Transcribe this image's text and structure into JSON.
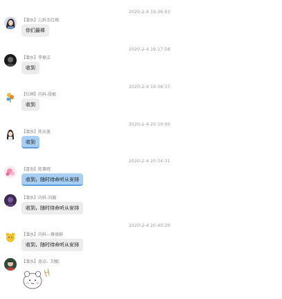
{
  "timestamps": [
    "2020-2-4 19:36:03",
    "2020-2-4 19:17:58",
    "2020-2-4 19:38:37",
    "2020-2-4 20:19:00",
    "2020-2-4 20:34:31",
    "2020-2-4 20:40:20"
  ],
  "messages": [
    {
      "sender": "【潜水】儿科王红梅",
      "text": "你们最棒",
      "avatar": "woman-dark-hair-avatar-icon"
    },
    {
      "sender": "【潜水】李振江",
      "text": "收到",
      "avatar": "black-portrait-avatar-icon"
    },
    {
      "sender": "【社牌】内科-段敏",
      "text": "收到",
      "avatar": "flower-avatar-icon"
    },
    {
      "sender": "【潜水】陈光美",
      "text": "收到",
      "avatar": "girl-avatar-icon"
    },
    {
      "sender": "【冒泡】陈秉辉",
      "text": "收到，随时待命听从安排",
      "avatar": "pink-flower-avatar-icon"
    },
    {
      "sender": "【潜水】内科-刘璐",
      "text": "收到，随时待命听从安排",
      "avatar": "purple-portrait-avatar-icon"
    },
    {
      "sender": "【潜水】内科—蔡德蔚",
      "text": "收到，随时待命听从安排",
      "avatar": "yellow-cartoon-avatar-icon"
    },
    {
      "sender": "【潜水】急诊、刘敏",
      "text": "",
      "avatar": "green-portrait-avatar-icon",
      "sticker": "cartoon-sticker-icon"
    }
  ],
  "colors": {
    "bubble_gray": "#ececec",
    "bubble_blue": "#a7cff5",
    "timestamp": "#9a9a9a"
  }
}
